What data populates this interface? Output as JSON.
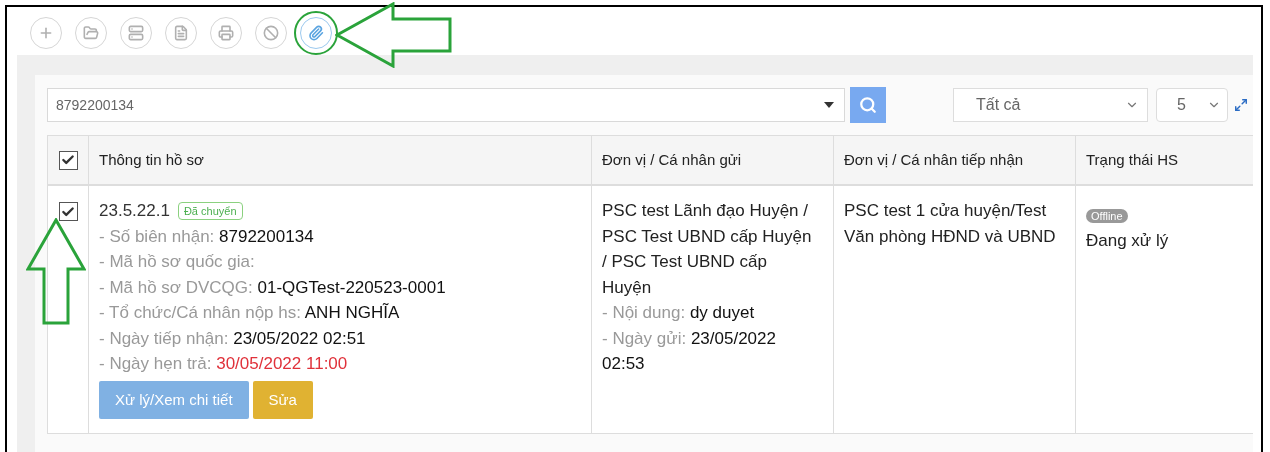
{
  "toolbar": {
    "buttons": [
      {
        "kind": "add",
        "selected": false
      },
      {
        "kind": "open",
        "selected": false
      },
      {
        "kind": "stack",
        "selected": false
      },
      {
        "kind": "list",
        "selected": false
      },
      {
        "kind": "print",
        "selected": false
      },
      {
        "kind": "cancel",
        "selected": false
      },
      {
        "kind": "attach",
        "selected": true
      }
    ]
  },
  "search": {
    "value": "8792200134"
  },
  "status_filter": {
    "value": "Tất cả"
  },
  "page_size": {
    "value": "5"
  },
  "table": {
    "header_checked": true,
    "columns": [
      {
        "label": "Thông tin hồ sơ"
      },
      {
        "label": "Đơn vị / Cá nhân gửi"
      },
      {
        "label": "Đơn vị / Cá nhân tiếp nhận"
      },
      {
        "label": "Trạng thái HS"
      }
    ],
    "rows": [
      {
        "checked": true,
        "code": "23.5.22.1",
        "badge": "Đã chuyển",
        "fields": [
          {
            "label": "- Số biên nhận:",
            "value": "8792200134",
            "kind": "normal"
          },
          {
            "label": "- Mã hồ sơ quốc gia:"
          },
          {
            "label": "- Mã hồ sơ DVCQG:",
            "value": "01-QGTest-220523-0001",
            "kind": "normal"
          },
          {
            "label": "- Tổ chức/Cá nhân nộp hs:",
            "value": "ANH NGHĨA",
            "kind": "normal"
          },
          {
            "label": "- Ngày tiếp nhận:",
            "value": "23/05/2022 02:51",
            "kind": "normal"
          },
          {
            "label": "- Ngày hẹn trả:",
            "value": "30/05/2022 11:00",
            "kind": "deadline"
          }
        ],
        "buttons": [
          {
            "label": "Xử lý/Xem chi tiết",
            "kind": "primary"
          },
          {
            "label": "Sửa",
            "kind": "warning"
          }
        ],
        "sender": {
          "name": "PSC test Lãnh đạo Huyện / PSC Test UBND cấp Huyện / PSC Test UBND cấp Huyện",
          "fields": [
            {
              "label": "- Nội dung:",
              "value": "dy duyet"
            },
            {
              "label": "- Ngày gửi:",
              "value": "23/05/2022 02:53"
            }
          ]
        },
        "receiver": "PSC test 1 cửa huyện/Test Văn phòng HĐND và UBND",
        "status_badge": "Offline",
        "status": "Đang xử lý"
      }
    ]
  }
}
